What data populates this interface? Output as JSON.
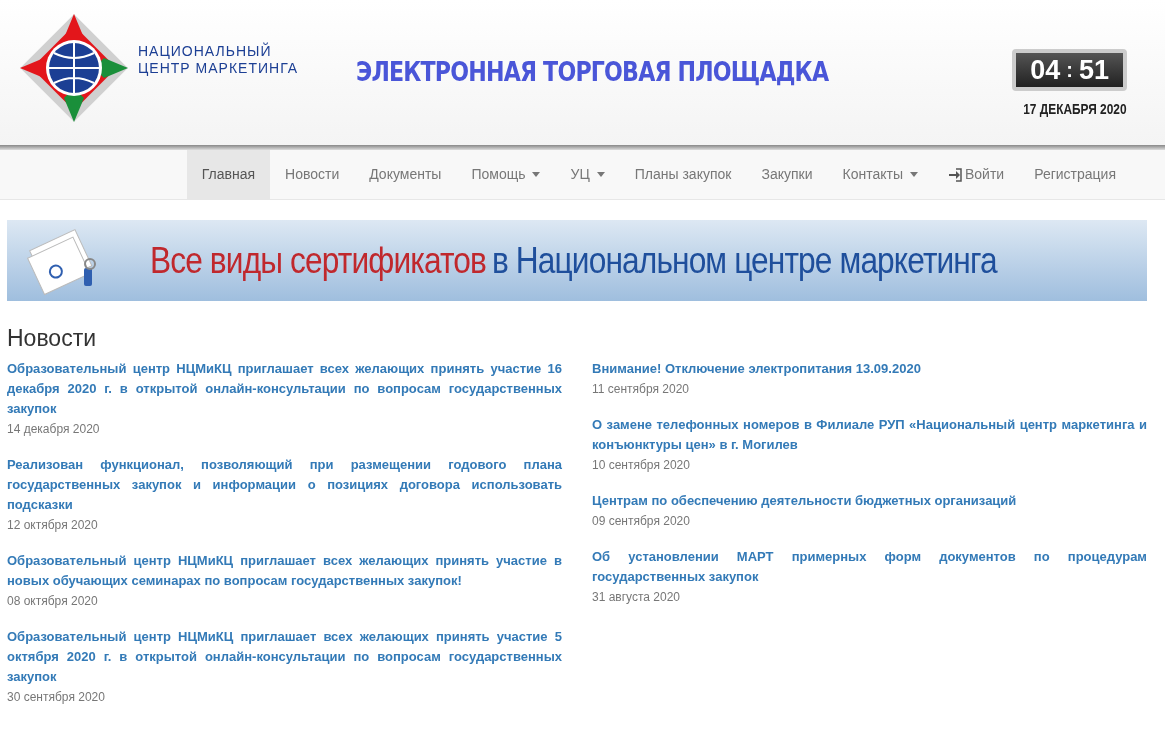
{
  "header": {
    "logo_text": [
      "НАЦИОНАЛЬНЫЙ",
      "ЦЕНТР МАРКЕТИНГА"
    ],
    "site_title": "ЭЛЕКТРОННАЯ ТОРГОВАЯ ПЛОЩАДКА",
    "clock": {
      "hours": "04",
      "separator": ":",
      "minutes": "51"
    },
    "date": "17 ДЕКАБРЯ 2020"
  },
  "nav": [
    {
      "label": "Главная",
      "selected": true,
      "dropdown": false,
      "kind": "link"
    },
    {
      "label": "Новости",
      "selected": false,
      "dropdown": false,
      "kind": "link"
    },
    {
      "label": "Документы",
      "selected": false,
      "dropdown": false,
      "kind": "link"
    },
    {
      "label": "Помощь",
      "selected": false,
      "dropdown": true,
      "kind": "link"
    },
    {
      "label": "УЦ",
      "selected": false,
      "dropdown": true,
      "kind": "link"
    },
    {
      "label": "Планы закупок",
      "selected": false,
      "dropdown": false,
      "kind": "link"
    },
    {
      "label": "Закупки",
      "selected": false,
      "dropdown": false,
      "kind": "link"
    },
    {
      "label": "Контакты",
      "selected": false,
      "dropdown": true,
      "kind": "link"
    },
    {
      "label": "Войти",
      "selected": false,
      "dropdown": false,
      "kind": "login"
    },
    {
      "label": "Регистрация",
      "selected": false,
      "dropdown": false,
      "kind": "link"
    }
  ],
  "banner": {
    "text_red": "Все виды сертификатов",
    "text_blue": "в Национальном центре маркетинга"
  },
  "news": {
    "title": "Новости",
    "columns": [
      [
        {
          "headline": "Образовательный центр НЦМиКЦ приглашает всех желающих принять участие 16 декабря 2020 г. в открытой онлайн-консультации по вопросам государственных закупок",
          "date": "14 декабря 2020"
        },
        {
          "headline": "Реализован функционал, позволяющий при размещении годового плана государственных закупок и информации о позициях договора использовать подсказки",
          "date": "12 октября 2020"
        },
        {
          "headline": "Образовательный центр НЦМиКЦ приглашает всех желающих принять участие в новых обучающих семинарах по вопросам государственных закупок!",
          "date": "08 октября 2020"
        },
        {
          "headline": "Образовательный центр НЦМиКЦ приглашает всех желающих принять участие 5 октября 2020 г. в открытой онлайн-консультации по вопросам государственных закупок",
          "date": "30 сентября 2020"
        }
      ],
      [
        {
          "headline": "Внимание! Отключение электропитания 13.09.2020",
          "date": "11 сентября 2020"
        },
        {
          "headline": "О замене телефонных номеров в Филиале РУП «Национальный центр маркетинга и конъюнктуры цен» в г. Могилев",
          "date": "10 сентября 2020"
        },
        {
          "headline": "Центрам по обеспечению деятельности бюджетных организаций",
          "date": "09 сентября 2020"
        },
        {
          "headline": "Об установлении МАРТ примерных форм документов по процедурам государственных закупок",
          "date": "31 августа 2020"
        }
      ]
    ]
  }
}
